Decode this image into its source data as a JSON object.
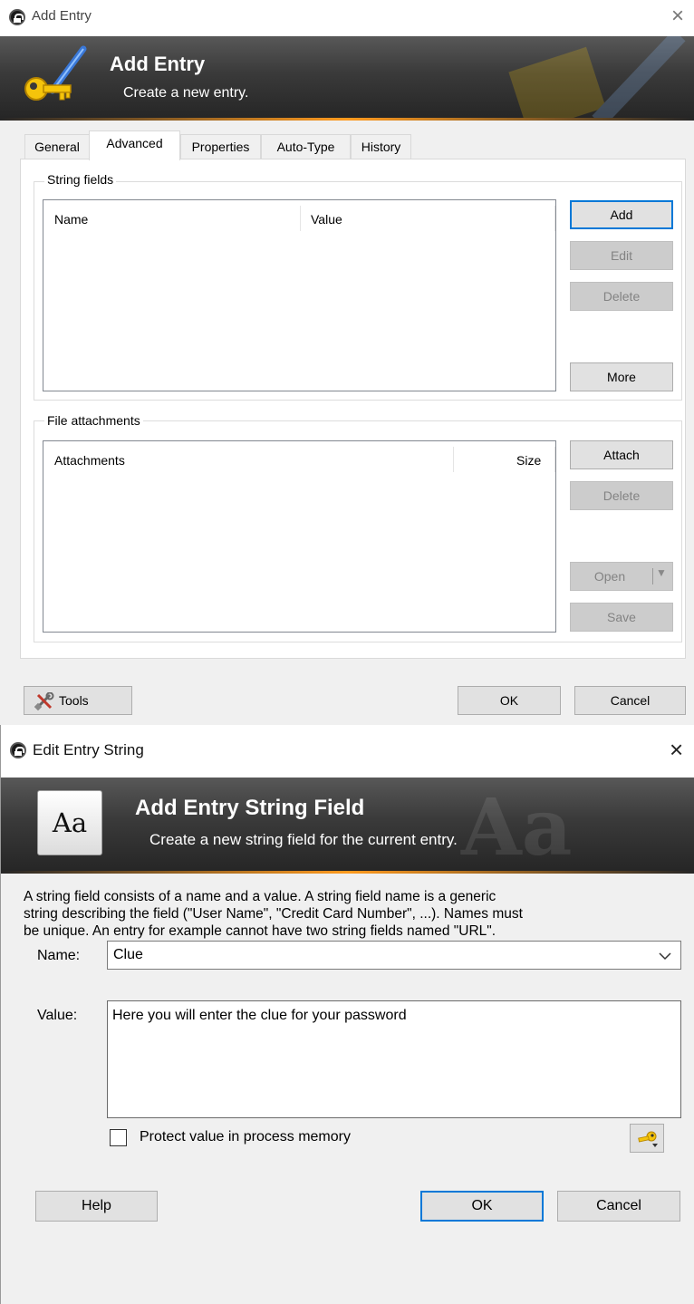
{
  "add_entry": {
    "title": "Add Entry",
    "banner": {
      "title": "Add Entry",
      "subtitle": "Create a new entry."
    },
    "tabs": [
      {
        "label": "General",
        "active": false
      },
      {
        "label": "Advanced",
        "active": true
      },
      {
        "label": "Properties",
        "active": false
      },
      {
        "label": "Auto-Type",
        "active": false
      },
      {
        "label": "History",
        "active": false
      }
    ],
    "string_fields": {
      "group_label": "String fields",
      "columns": [
        "Name",
        "Value"
      ],
      "buttons": {
        "add": "Add",
        "edit": "Edit",
        "delete": "Delete",
        "more": "More"
      }
    },
    "file_attachments": {
      "group_label": "File attachments",
      "columns": [
        "Attachments",
        "Size"
      ],
      "buttons": {
        "attach": "Attach",
        "delete": "Delete",
        "open": "Open",
        "save": "Save"
      }
    },
    "footer": {
      "tools": "Tools",
      "ok": "OK",
      "cancel": "Cancel"
    }
  },
  "edit_string": {
    "title": "Edit Entry String",
    "banner": {
      "title": "Add Entry String Field",
      "subtitle": "Create a new string field for the current entry.",
      "icon_text": "Aa"
    },
    "description": [
      "A string field consists of a name and a value. A string field name is a generic",
      "string describing the field (\"User Name\", \"Credit Card Number\", ...). Names must",
      "be unique. An entry for example cannot have two string fields named \"URL\"."
    ],
    "name_label": "Name:",
    "name_value": "Clue",
    "value_label": "Value:",
    "value_text": "Here you will enter the clue for your password",
    "protect_label": "Protect value in process memory",
    "protect_checked": false,
    "buttons": {
      "help": "Help",
      "ok": "OK",
      "cancel": "Cancel"
    }
  },
  "colors": {
    "accent": "#0078d7",
    "banner_line": "#ff9b1f",
    "banner_dark": "#262626"
  }
}
